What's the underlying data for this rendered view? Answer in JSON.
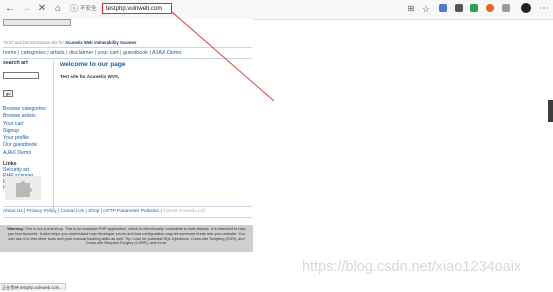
{
  "browser": {
    "url": "testphp.vulnweb.com",
    "insecure_label": "不安全",
    "status_text": "正在等待 testphp.vulnweb.com..."
  },
  "site": {
    "tagline_prefix": "TEST and Demonstration site for",
    "tagline_brand": "Acunetix Web Vulnerability Scanner",
    "top_nav": [
      "home",
      "categories",
      "artists",
      "disclaimer",
      "your cart",
      "guestbook",
      "AJAX Demo"
    ],
    "sidebar": {
      "search_heading": "search art",
      "go_label": "go",
      "links": [
        "Browse categories",
        "Browse artists",
        "Your cart",
        "Signup",
        "Your profile",
        "Our guestbook",
        "AJAX Demo"
      ],
      "links_heading": "Links",
      "external_links": [
        "Security art",
        "PHP scanner",
        "PHP vuln help",
        "Fractal Explorer"
      ]
    },
    "main_title": "welcome to our page",
    "main_text": "Test site for Acunetix WVS.",
    "footer_links": [
      "About Us",
      "Privacy Policy",
      "Contact Us",
      "Shop",
      "HTTP Parameter Pollution"
    ],
    "footer_copyright": "©2019 Acunetix Ltd",
    "warning_label": "Warning",
    "warning_text": ": This is not a real shop. This is an example PHP application, which is intentionally vulnerable to web attacks. It is intended to help you test Acunetix. It also helps you understand how developer errors and bad configuration may let someone break into your website. You can use it to test other tools and your manual hacking skills as well. Tip: Look for potential SQL Injections, Cross-site Scripting (XSS), and Cross-site Request Forgery (CSRF), and more."
  },
  "watermark": "https://blog.csdn.net/xiao1234oaix",
  "colors": {
    "link": "#1b5fa6",
    "annotation_red": "#d93025",
    "warning_bg": "#cfcfcf"
  },
  "icons": [
    "back-icon",
    "forward-icon",
    "reload-icon",
    "home-icon",
    "info-icon",
    "translate-icon",
    "star-icon",
    "extension-icon",
    "profile-avatar-icon",
    "menu-icon"
  ]
}
